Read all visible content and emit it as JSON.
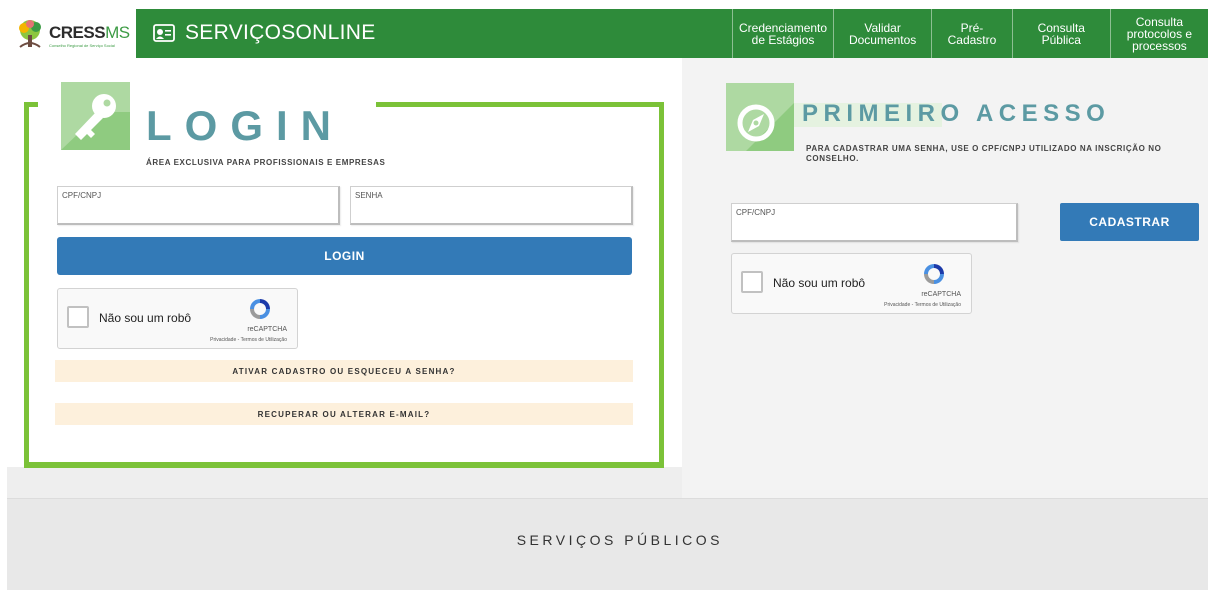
{
  "header": {
    "logo_text": "CRESS",
    "logo_suffix": "MS",
    "logo_sub": "Conselho Regional de Serviço Social",
    "servicos_title": "SERVIÇOSONLINE",
    "nav": [
      {
        "label": "Credenciamento de Estágios"
      },
      {
        "label": "Validar Documentos"
      },
      {
        "label": "Pré-Cadastro"
      },
      {
        "label": "Consulta Pública"
      },
      {
        "label": "Consulta protocolos e processos"
      }
    ],
    "brand_color": "#2e8b3a"
  },
  "login": {
    "title": "LOGIN",
    "subtitle": "ÁREA EXCLUSIVA PARA PROFISSIONAIS E EMPRESAS",
    "cpf_label": "CPF/CNPJ",
    "cpf_value": "",
    "senha_label": "SENHA",
    "senha_value": "",
    "submit_label": "LOGIN",
    "captcha": {
      "label": "Não sou um robô",
      "brand": "reCAPTCHA",
      "links": "Privacidade - Termos de Utilização"
    },
    "activate_link": "ATIVAR CADASTRO OU ESQUECEU A SENHA?",
    "recover_link": "RECUPERAR OU ALTERAR E-MAIL?",
    "frame_color": "#7bc238"
  },
  "primeiro_acesso": {
    "title": "PRIMEIRO ACESSO",
    "subtitle": "PARA CADASTRAR UMA SENHA, USE O CPF/CNPJ UTILIZADO NA INSCRIÇÃO NO CONSELHO.",
    "cpf_label": "CPF/CNPJ",
    "cpf_value": "",
    "submit_label": "CADASTRAR",
    "captcha": {
      "label": "Não sou um robô",
      "brand": "reCAPTCHA",
      "links": "Privacidade - Termos de Utilização"
    }
  },
  "footer": {
    "title": "SERVIÇOS PÚBLICOS"
  },
  "colors": {
    "primary_button": "#337ab7",
    "accent_text": "#5c9aa3",
    "icon_tile": "#aed9a2",
    "link_bar": "#fdf0dc"
  }
}
